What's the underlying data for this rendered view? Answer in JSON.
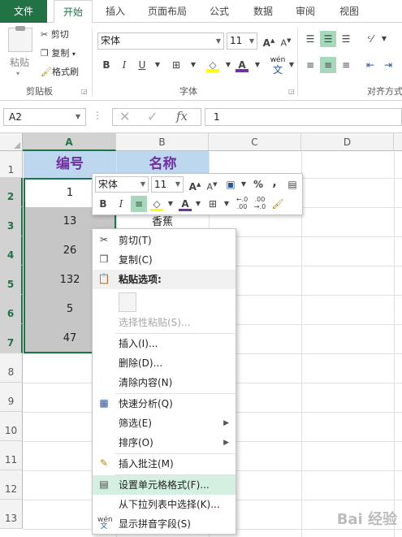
{
  "ribbon_tabs": [
    {
      "label": "文件",
      "active": false,
      "file": true
    },
    {
      "label": "开始",
      "active": true
    },
    {
      "label": "插入"
    },
    {
      "label": "页面布局"
    },
    {
      "label": "公式"
    },
    {
      "label": "数据"
    },
    {
      "label": "审阅"
    },
    {
      "label": "视图"
    }
  ],
  "clipboard": {
    "paste_label": "粘贴",
    "cut_label": "剪切",
    "copy_label": "复制",
    "format_painter_label": "格式刷",
    "group_label": "剪贴板"
  },
  "font_group": {
    "font_name": "宋体",
    "font_size": "11",
    "bold": "B",
    "italic": "I",
    "underline": "U",
    "group_label": "字体",
    "wen_label": "wén",
    "wen_char": "文",
    "grow": "A",
    "shrink": "A"
  },
  "align_group": {
    "group_label": "对齐方式"
  },
  "formula_bar": {
    "name_box": "A2",
    "fx_label": "fx",
    "value": "1"
  },
  "columns": [
    "A",
    "B",
    "C",
    "D"
  ],
  "rows": [
    "1",
    "2",
    "3",
    "4",
    "5",
    "6",
    "7",
    "8",
    "9",
    "10",
    "11",
    "12",
    "13"
  ],
  "cells": {
    "A1": "编号",
    "B1": "名称",
    "A2": "1",
    "A3": "13",
    "B3": "香蕉",
    "A4": "26",
    "A5": "132",
    "A6": "5",
    "A7": "47"
  },
  "colors": {
    "accent": "#217346",
    "header_fill": "#bdd7ee",
    "header_text": "#7030a0",
    "selection_fill": "#c6c6c6",
    "menu_highlight": "#d3f0e0"
  },
  "mini_toolbar": {
    "font_name": "宋体",
    "font_size": "11",
    "percent": "%",
    "comma": ",",
    "bold": "B",
    "italic": "I",
    "font_color": "A",
    "grow": "A",
    "shrink": "A",
    "inc_decimal": "←.0 .00",
    "dec_decimal": ".00 →.0"
  },
  "context_menu": {
    "cut": "剪切(T)",
    "copy": "复制(C)",
    "paste_options": "粘贴选项:",
    "paste_special": "选择性粘贴(S)...",
    "insert": "插入(I)...",
    "delete": "删除(D)...",
    "clear": "清除内容(N)",
    "quick_analysis": "快速分析(Q)",
    "filter": "筛选(E)",
    "sort": "排序(O)",
    "insert_comment": "插入批注(M)",
    "format_cells": "设置单元格格式(F)...",
    "pick_list": "从下拉列表中选择(K)...",
    "phonetic": "显示拼音字段(S)"
  },
  "watermark": "Bai 经验"
}
